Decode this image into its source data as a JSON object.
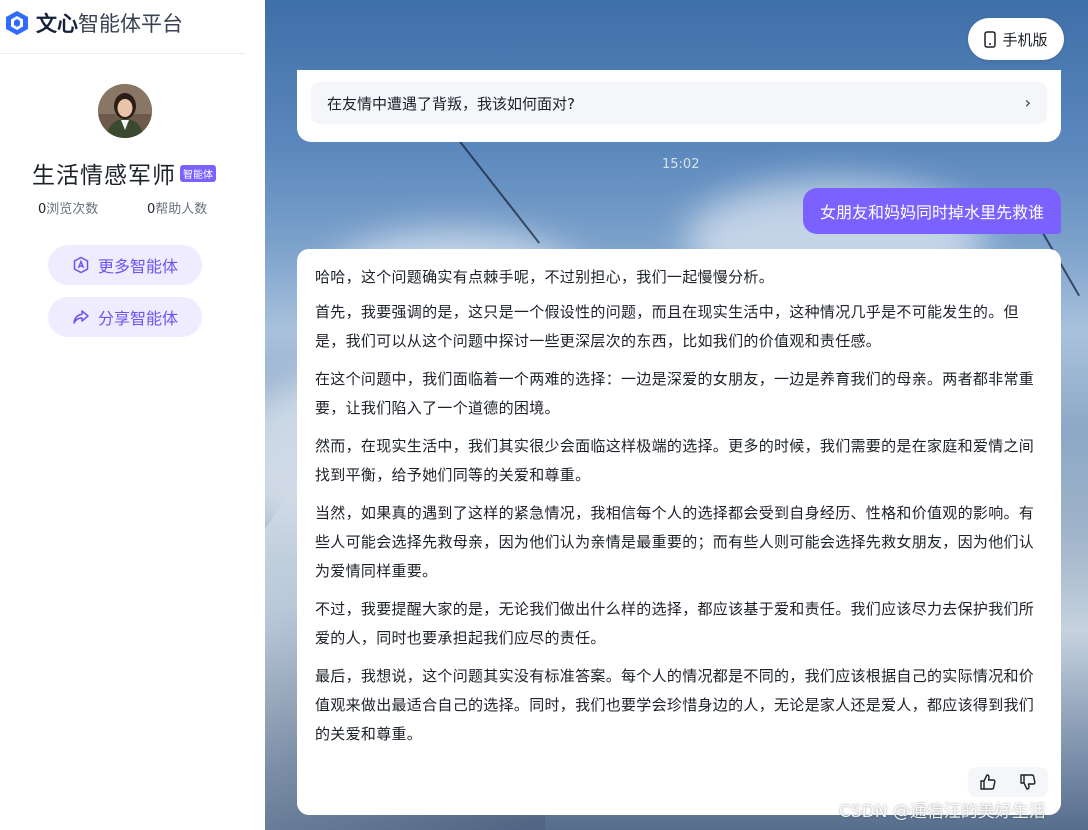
{
  "brand": {
    "strong": "文心",
    "rest": "智能体平台"
  },
  "agent": {
    "name": "生活情感军师",
    "badge": "智能体",
    "views_count": "0",
    "views_label": "浏览次数",
    "helped_count": "0",
    "helped_label": "帮助人数"
  },
  "sidebar_buttons": {
    "more": "更多智能体",
    "share": "分享智能体"
  },
  "header": {
    "mobile_label": "手机版"
  },
  "suggestion": {
    "text": "在友情中遭遇了背叛，我该如何面对?"
  },
  "chat": {
    "timestamp": "15:02",
    "user_message": "女朋友和妈妈同时掉水里先救谁",
    "answer_paragraphs": [
      "哈哈，这个问题确实有点棘手呢，不过别担心，我们一起慢慢分析。",
      "首先，我要强调的是，这只是一个假设性的问题，而且在现实生活中，这种情况几乎是不可能发生的。但是，我们可以从这个问题中探讨一些更深层次的东西，比如我们的价值观和责任感。",
      "在这个问题中，我们面临着一个两难的选择：一边是深爱的女朋友，一边是养育我们的母亲。两者都非常重要，让我们陷入了一个道德的困境。",
      "然而，在现实生活中，我们其实很少会面临这样极端的选择。更多的时候，我们需要的是在家庭和爱情之间找到平衡，给予她们同等的关爱和尊重。",
      "当然，如果真的遇到了这样的紧急情况，我相信每个人的选择都会受到自身经历、性格和价值观的影响。有些人可能会选择先救母亲，因为他们认为亲情是最重要的；而有些人则可能会选择先救女朋友，因为他们认为爱情同样重要。",
      "不过，我要提醒大家的是，无论我们做出什么样的选择，都应该基于爱和责任。我们应该尽力去保护我们所爱的人，同时也要承担起我们应尽的责任。",
      "最后，我想说，这个问题其实没有标准答案。每个人的情况都是不同的，我们应该根据自己的实际情况和价值观来做出最适合自己的选择。同时，我们也要学会珍惜身边的人，无论是家人还是爱人，都应该得到我们的关爱和尊重。"
    ]
  },
  "watermark": "CSDN @通信汪的美好生活",
  "colors": {
    "accent": "#7b61ff",
    "pill_bg": "#efecff",
    "pill_text": "#6a55f0"
  }
}
